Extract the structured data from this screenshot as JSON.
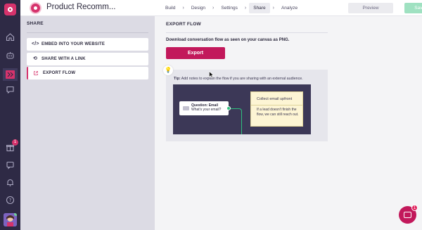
{
  "app": {
    "title": "Product Recomm..."
  },
  "nav": {
    "steps": [
      "Build",
      "Design",
      "Settings",
      "Share",
      "Analyze"
    ],
    "active_step": "Share",
    "preview_label": "Preview",
    "saved_label": "Saved"
  },
  "rail": {
    "icons": [
      "home-icon",
      "bot-icon",
      "flow-icon",
      "chat-icon",
      "gift-icon",
      "message-icon",
      "bell-icon",
      "help-icon"
    ],
    "gift_badge": "1"
  },
  "share_panel": {
    "heading": "SHARE",
    "items": [
      {
        "label": "EMBED INTO YOUR WEBSITE",
        "icon": "code-icon"
      },
      {
        "label": "SHARE WITH A LINK",
        "icon": "link-icon"
      },
      {
        "label": "EXPORT FLOW",
        "icon": "external-link-icon"
      }
    ],
    "active_item": "EXPORT FLOW"
  },
  "export": {
    "heading": "EXPORT FLOW",
    "description": "Download conversation flow as seen on your canvas as PNG.",
    "button_label": "Export",
    "tip_prefix": "Tip:",
    "tip_text": " Add notes to explain the flow if you are sharing with an external audience.",
    "preview": {
      "question_title": "Question: Email",
      "question_body": "What's your email?",
      "note_title": "Collect email upfront",
      "note_body": "If a lead doesn't finish the flow, we can still reach out."
    }
  },
  "chat": {
    "badge": "1"
  },
  "colors": {
    "brand": "#c2185b",
    "rail": "#2e2a45",
    "saved": "#9fe1c1",
    "connector": "#2ec27e"
  }
}
